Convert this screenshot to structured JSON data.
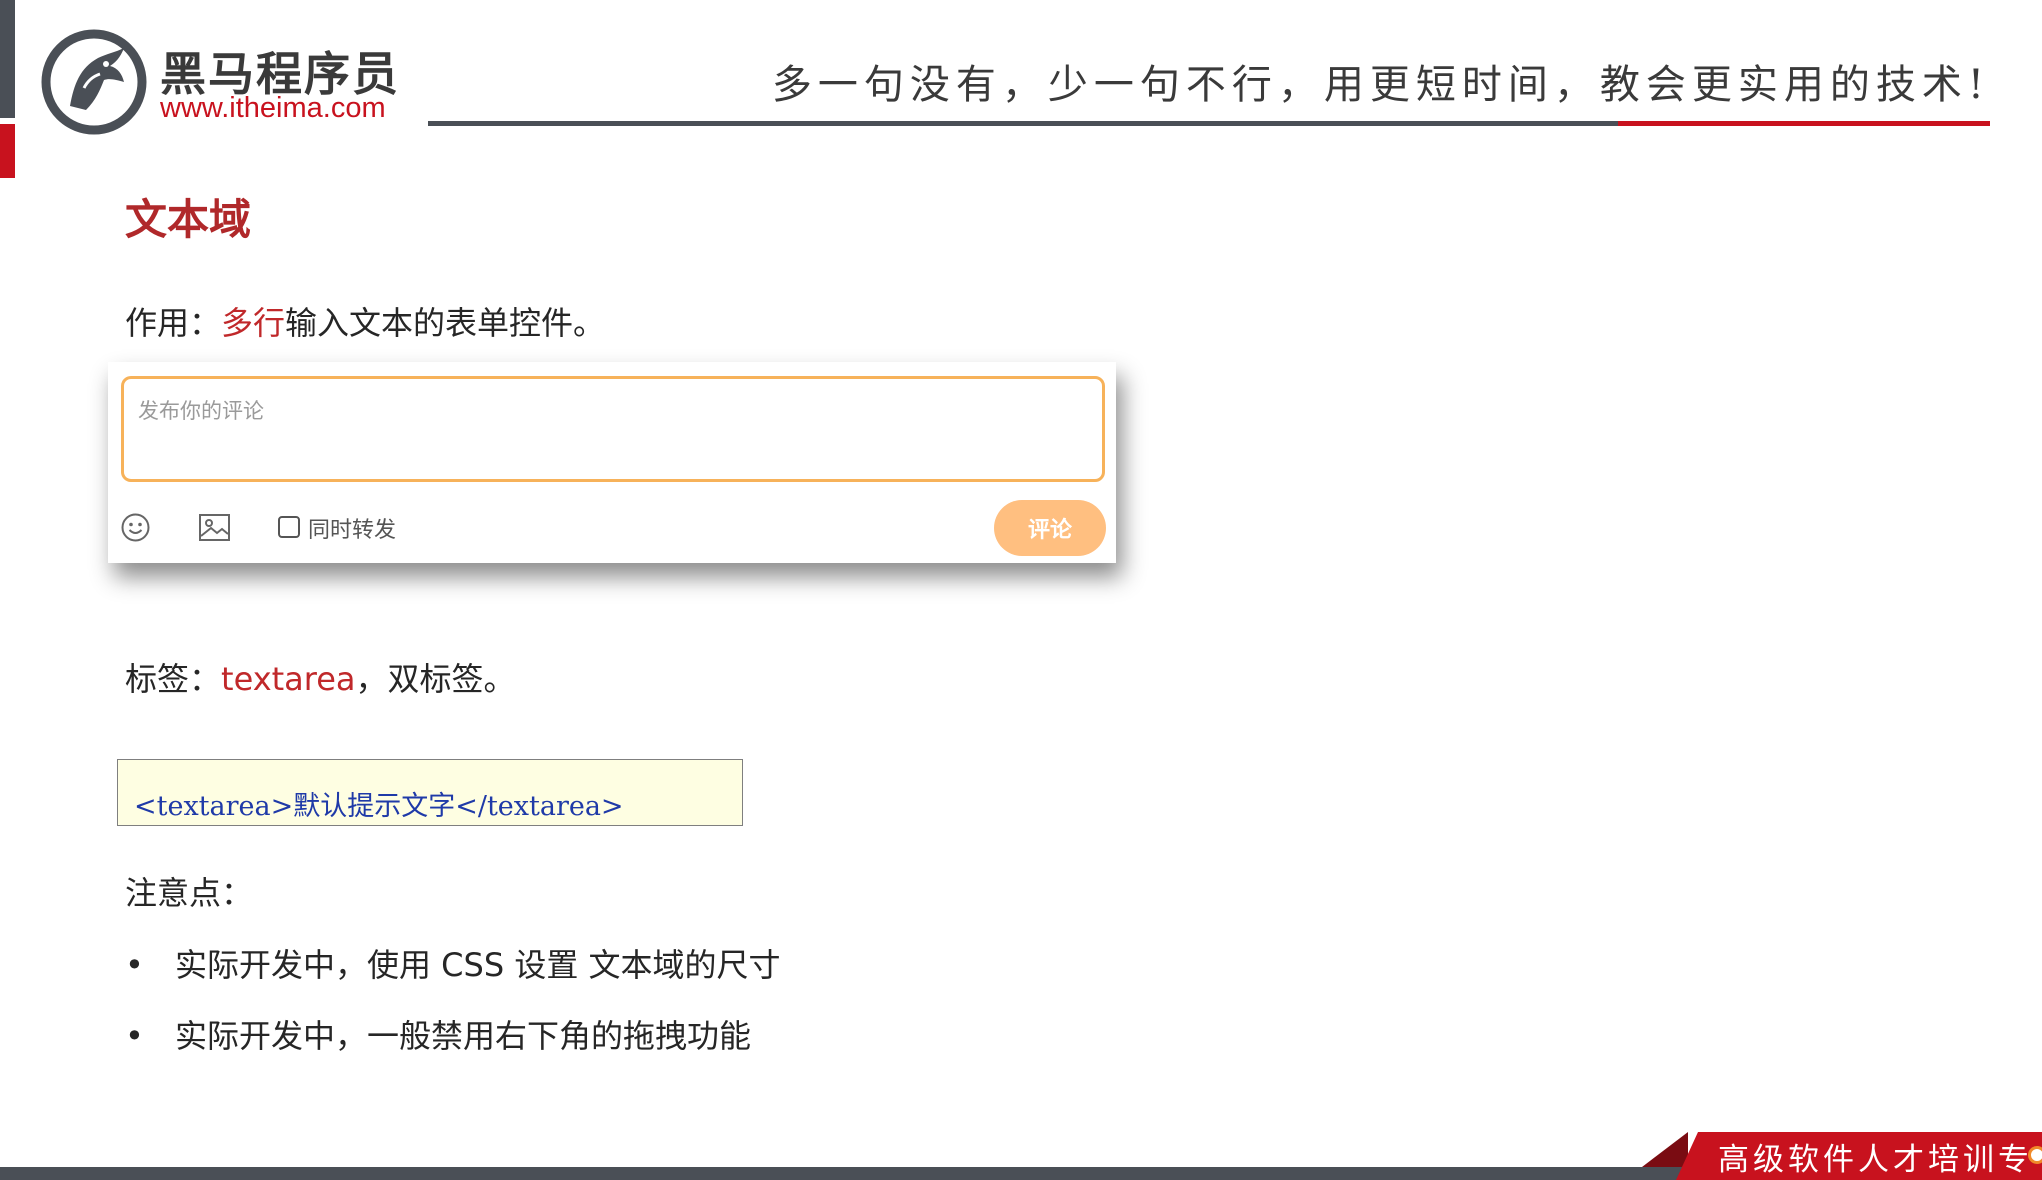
{
  "header": {
    "brand_cn": "黑马程序员",
    "brand_url": "www.itheima.com",
    "slogan": "多一句没有，少一句不行，用更短时间，教会更实用的技术!"
  },
  "slide": {
    "title": "文本域",
    "usage": {
      "label": "作用：",
      "highlight": "多行",
      "rest": "输入文本的表单控件。"
    },
    "demo": {
      "placeholder": "发布你的评论",
      "repost_label": "同时转发",
      "submit_label": "评论",
      "icons": [
        "emoji-icon",
        "image-icon"
      ]
    },
    "tag": {
      "label": "标签：",
      "highlight": "textarea",
      "rest": "，双标签。"
    },
    "code": "<textarea>默认提示文字</textarea>",
    "notes_heading": "注意点：",
    "notes": [
      {
        "bullet": "•",
        "text": "实际开发中，使用 CSS 设置 文本域的尺寸"
      },
      {
        "bullet": "•",
        "text": "实际开发中，一般禁用右下角的拖拽功能"
      }
    ]
  },
  "footer": {
    "text": "高级软件人才培训专"
  },
  "colors": {
    "accent_red": "#c8121e",
    "title_red": "#b0282a",
    "dark_gray": "#4a4f56",
    "code_blue": "#1f3aa8",
    "code_bg": "#fefee2",
    "textarea_border": "#f7b25a",
    "button_orange": "#ffbf80"
  }
}
